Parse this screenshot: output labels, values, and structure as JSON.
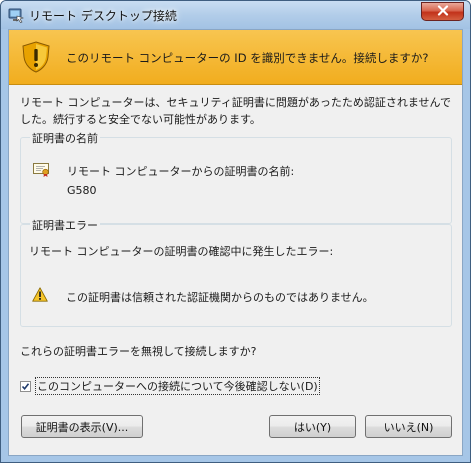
{
  "window": {
    "title": "リモート デスクトップ接続"
  },
  "banner": {
    "message": "このリモート コンピューターの ID を識別できません。接続しますか?"
  },
  "description": "リモート コンピューターは、セキュリティ証明書に問題があったため認証されませんでした。続行すると安全でない可能性があります。",
  "cert_name_group": {
    "title": "証明書の名前",
    "label": "リモート コンピューターからの証明書の名前:",
    "value": "G580"
  },
  "cert_error_group": {
    "title": "証明書エラー",
    "label": "リモート コンピューターの証明書の確認中に発生したエラー:",
    "error": "この証明書は信頼された認証機関からのものではありません。"
  },
  "question": "これらの証明書エラーを無視して接続しますか?",
  "checkbox": {
    "label": "このコンピューターへの接続について今後確認しない(D)",
    "checked": true
  },
  "buttons": {
    "view_cert": "証明書の表示(V)...",
    "yes": "はい(Y)",
    "no": "いいえ(N)"
  },
  "colors": {
    "banner": "#f1ad1e",
    "title_bar": "#a6c6e7",
    "close_button": "#c2321a"
  },
  "icons": {
    "app": "remote-desktop-icon",
    "banner": "shield-warning-icon",
    "certificate": "certificate-icon",
    "warning": "warning-triangle-icon",
    "close": "close-icon"
  }
}
